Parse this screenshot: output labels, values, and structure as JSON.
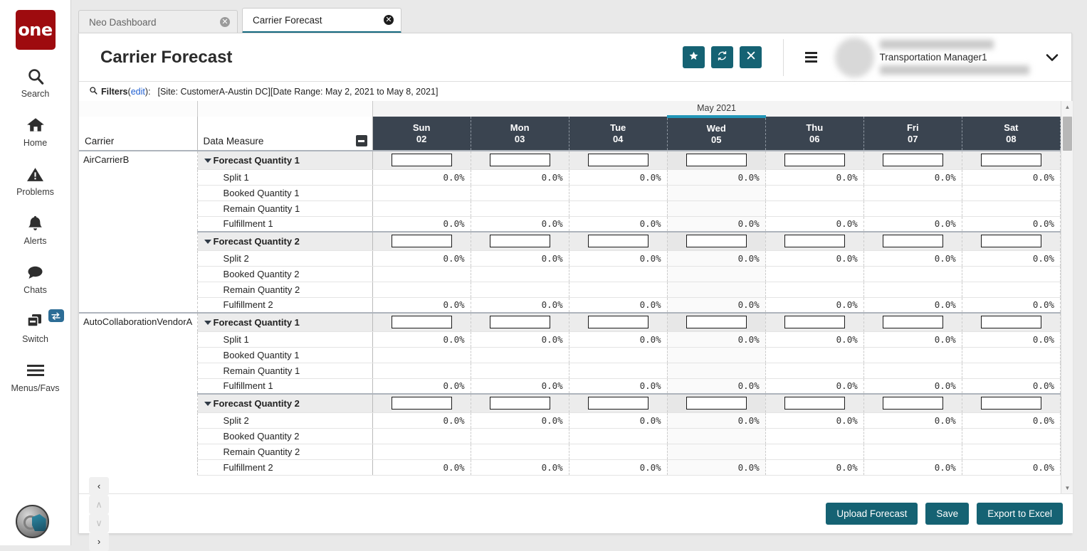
{
  "rail": {
    "logo_text": "one",
    "items": [
      {
        "label": "Search",
        "icon": "search-icon"
      },
      {
        "label": "Home",
        "icon": "home-icon"
      },
      {
        "label": "Problems",
        "icon": "warning-triangle-icon"
      },
      {
        "label": "Alerts",
        "icon": "bell-icon"
      },
      {
        "label": "Chats",
        "icon": "chat-bubble-icon"
      },
      {
        "label": "Switch",
        "icon": "windows-stack-icon",
        "badge_icon": "swap-arrows-icon"
      },
      {
        "label": "Menus/Favs",
        "icon": "hamburger-icon"
      }
    ]
  },
  "tabs": [
    {
      "label": "Neo Dashboard",
      "active": false,
      "close_icon": "close-circle-icon"
    },
    {
      "label": "Carrier Forecast",
      "active": true,
      "close_icon": "close-circle-icon"
    }
  ],
  "header": {
    "title": "Carrier Forecast",
    "actions": [
      {
        "name": "favorite-button",
        "icon": "star-icon"
      },
      {
        "name": "refresh-button",
        "icon": "refresh-icon"
      },
      {
        "name": "close-button",
        "icon": "x-icon"
      }
    ],
    "menu_icon": "hamburger-icon",
    "user_role": "Transportation Manager1",
    "caret_icon": "chevron-down-icon"
  },
  "filters": {
    "icon": "search-icon",
    "label": "Filters",
    "open_paren": "(",
    "edit_link": "edit",
    "close_paren": "):",
    "summary": "[Site: CustomerA-Austin DC][Date Range: May 2, 2021 to May 8, 2021]"
  },
  "grid": {
    "month_label": "May 2021",
    "col_carrier": "Carrier",
    "col_measure": "Data Measure",
    "collapse_all_icon": "minus-box-icon",
    "days": [
      {
        "dow": "Sun",
        "num": "02",
        "today": false
      },
      {
        "dow": "Mon",
        "num": "03",
        "today": false
      },
      {
        "dow": "Tue",
        "num": "04",
        "today": false
      },
      {
        "dow": "Wed",
        "num": "05",
        "today": true
      },
      {
        "dow": "Thu",
        "num": "06",
        "today": false
      },
      {
        "dow": "Fri",
        "num": "07",
        "today": false
      },
      {
        "dow": "Sat",
        "num": "08",
        "today": false
      }
    ],
    "accent_today": "#2196b8",
    "header_bg": "#3a4450",
    "carriers": [
      {
        "name": "AirCarrierB",
        "groups": [
          {
            "label": "Forecast Quantity 1",
            "type": "input",
            "values": [
              "",
              "",
              "",
              "",
              "",
              "",
              ""
            ],
            "rows": [
              {
                "label": "Split 1",
                "values": [
                  "0.0%",
                  "0.0%",
                  "0.0%",
                  "0.0%",
                  "0.0%",
                  "0.0%",
                  "0.0%"
                ]
              },
              {
                "label": "Booked Quantity 1",
                "values": [
                  "",
                  "",
                  "",
                  "",
                  "",
                  "",
                  ""
                ]
              },
              {
                "label": "Remain Quantity 1",
                "values": [
                  "",
                  "",
                  "",
                  "",
                  "",
                  "",
                  ""
                ]
              },
              {
                "label": "Fulfillment 1",
                "values": [
                  "0.0%",
                  "0.0%",
                  "0.0%",
                  "0.0%",
                  "0.0%",
                  "0.0%",
                  "0.0%"
                ]
              }
            ]
          },
          {
            "label": "Forecast Quantity 2",
            "type": "input",
            "values": [
              "",
              "",
              "",
              "",
              "",
              "",
              ""
            ],
            "rows": [
              {
                "label": "Split 2",
                "values": [
                  "0.0%",
                  "0.0%",
                  "0.0%",
                  "0.0%",
                  "0.0%",
                  "0.0%",
                  "0.0%"
                ]
              },
              {
                "label": "Booked Quantity 2",
                "values": [
                  "",
                  "",
                  "",
                  "",
                  "",
                  "",
                  ""
                ]
              },
              {
                "label": "Remain Quantity 2",
                "values": [
                  "",
                  "",
                  "",
                  "",
                  "",
                  "",
                  ""
                ]
              },
              {
                "label": "Fulfillment 2",
                "values": [
                  "0.0%",
                  "0.0%",
                  "0.0%",
                  "0.0%",
                  "0.0%",
                  "0.0%",
                  "0.0%"
                ]
              }
            ]
          }
        ]
      },
      {
        "name": "AutoCollaborationVendorA",
        "groups": [
          {
            "label": "Forecast Quantity 1",
            "type": "input",
            "values": [
              "",
              "",
              "",
              "",
              "",
              "",
              ""
            ],
            "rows": [
              {
                "label": "Split 1",
                "values": [
                  "0.0%",
                  "0.0%",
                  "0.0%",
                  "0.0%",
                  "0.0%",
                  "0.0%",
                  "0.0%"
                ]
              },
              {
                "label": "Booked Quantity 1",
                "values": [
                  "",
                  "",
                  "",
                  "",
                  "",
                  "",
                  ""
                ]
              },
              {
                "label": "Remain Quantity 1",
                "values": [
                  "",
                  "",
                  "",
                  "",
                  "",
                  "",
                  ""
                ]
              },
              {
                "label": "Fulfillment 1",
                "values": [
                  "0.0%",
                  "0.0%",
                  "0.0%",
                  "0.0%",
                  "0.0%",
                  "0.0%",
                  "0.0%"
                ]
              }
            ]
          },
          {
            "label": "Forecast Quantity 2",
            "type": "input",
            "values": [
              "",
              "",
              "",
              "",
              "",
              "",
              ""
            ],
            "rows": [
              {
                "label": "Split 2",
                "values": [
                  "0.0%",
                  "0.0%",
                  "0.0%",
                  "0.0%",
                  "0.0%",
                  "0.0%",
                  "0.0%"
                ]
              },
              {
                "label": "Booked Quantity 2",
                "values": [
                  "",
                  "",
                  "",
                  "",
                  "",
                  "",
                  ""
                ]
              },
              {
                "label": "Remain Quantity 2",
                "values": [
                  "",
                  "",
                  "",
                  "",
                  "",
                  "",
                  ""
                ]
              },
              {
                "label": "Fulfillment 2",
                "values": [
                  "0.0%",
                  "0.0%",
                  "0.0%",
                  "0.0%",
                  "0.0%",
                  "0.0%",
                  "0.0%"
                ]
              }
            ]
          }
        ]
      }
    ]
  },
  "footer": {
    "pager": [
      {
        "name": "page-prev-button",
        "glyph": "‹",
        "enabled": true
      },
      {
        "name": "page-up-button",
        "glyph": "∧",
        "enabled": false
      },
      {
        "name": "page-down-button",
        "glyph": "∨",
        "enabled": false
      },
      {
        "name": "page-next-button",
        "glyph": "›",
        "enabled": true
      }
    ],
    "buttons": [
      {
        "name": "upload-forecast-button",
        "label": "Upload Forecast"
      },
      {
        "name": "save-button",
        "label": "Save"
      },
      {
        "name": "export-to-excel-button",
        "label": "Export to Excel"
      }
    ]
  },
  "colors": {
    "brand_red": "#9e0b0f",
    "teal": "#156273",
    "accent": "#2196b8",
    "link": "#1f5fd1"
  }
}
